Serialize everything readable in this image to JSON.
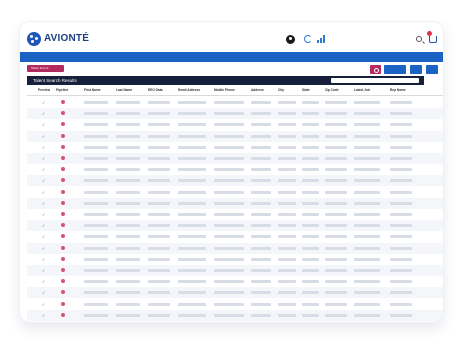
{
  "app": {
    "logo_text": "AVIONTÉ",
    "brand_color": "#1f57b6",
    "accent_color": "#b22a5f",
    "nav_bar_color": "#1a62c4"
  },
  "toolbar": {
    "talent_button_label": "Talent Forms",
    "user_icon": "user-circle-icon",
    "refresh_icon": "refresh-icon",
    "signal_icon": "signal-icon",
    "search_icon": "search-icon",
    "cart_icon": "cart-icon"
  },
  "table": {
    "title": "Talent Search Results",
    "columns": [
      "Preview",
      "Pipeline",
      "First Name",
      "Last Name",
      "EEO Data",
      "Email Address",
      "Mobile Phone",
      "Address",
      "City",
      "State",
      "Zip Code",
      "Latest Job",
      "Rep Name"
    ],
    "row_count": 20
  }
}
